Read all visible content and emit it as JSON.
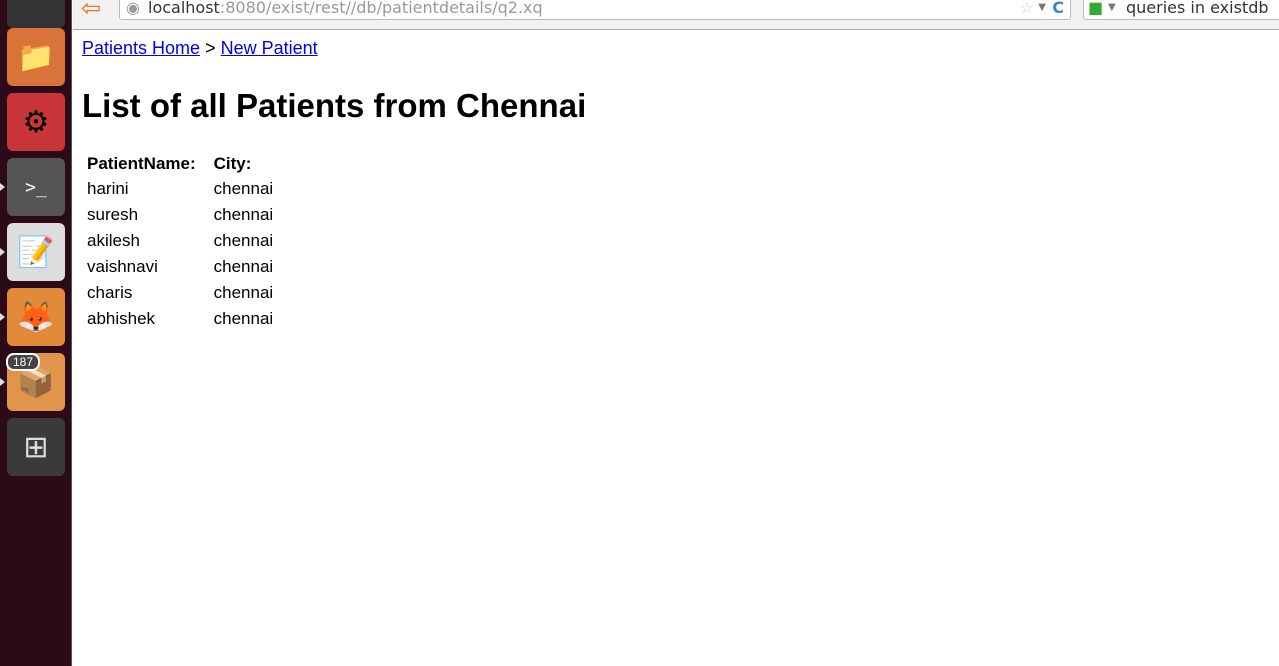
{
  "browser": {
    "url_host": "localhost",
    "url_rest": ":8080/exist/rest//db/patientdetails/q2.xq",
    "search_text": "queries in existdb"
  },
  "launcher": {
    "badge": "187"
  },
  "breadcrumb": {
    "home": "Patients Home",
    "sep": ">",
    "new": "New Patient"
  },
  "title": "List of all Patients from Chennai",
  "table": {
    "headers": [
      "PatientName:",
      "City:"
    ],
    "rows": [
      [
        "harini",
        "chennai"
      ],
      [
        "suresh",
        "chennai"
      ],
      [
        "akilesh",
        "chennai"
      ],
      [
        "vaishnavi",
        "chennai"
      ],
      [
        "charis",
        "chennai"
      ],
      [
        "abhishek",
        "chennai"
      ]
    ]
  }
}
